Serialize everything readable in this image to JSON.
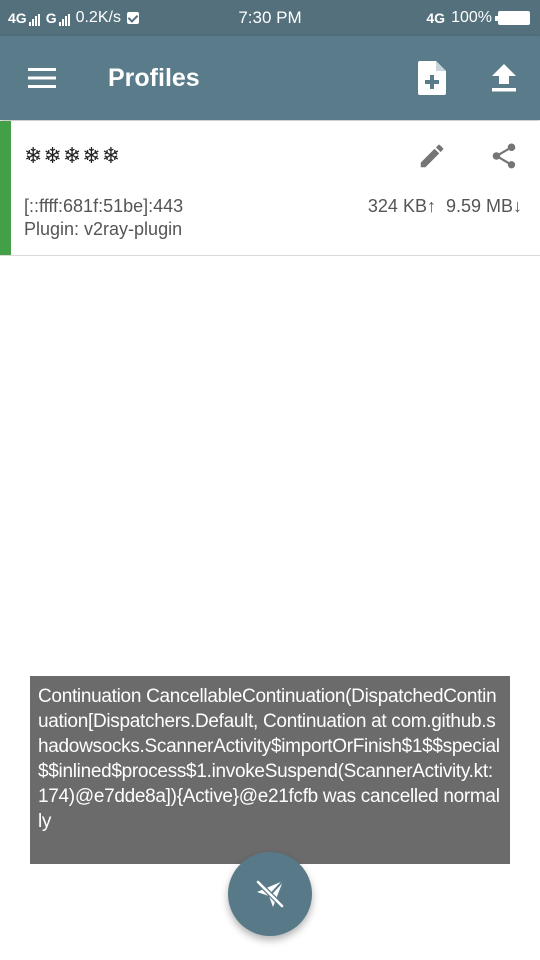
{
  "status_bar": {
    "network1": "4G",
    "network2": "G",
    "speed": "0.2K/s",
    "time": "7:30 PM",
    "network3": "4G",
    "battery": "100%"
  },
  "app_bar": {
    "title": "Profiles",
    "menu_icon": "menu-icon",
    "new_profile_icon": "add-file-icon",
    "import_icon": "upload-icon"
  },
  "profile": {
    "name": "❄❄❄❄❄",
    "address": "[::ffff:681f:51be]:443",
    "plugin": "Plugin: v2ray-plugin",
    "tx": "324 KB↑",
    "rx": "9.59 MB↓",
    "active_color": "#43a047",
    "edit_icon": "pencil-icon",
    "share_icon": "share-icon"
  },
  "toast": {
    "message": "Continuation CancellableContinuation(DispatchedContinuation[Dispatchers.Default, Continuation at com.github.shadowsocks.ScannerActivity$importOrFinish$1$$special$$inlined$process$1.invokeSuspend(ScannerActivity.kt:174)@e7dde8a]){Active}@e21fcfb was cancelled normally"
  },
  "fab": {
    "icon": "airplane-off-icon"
  },
  "colors": {
    "status_bar": "#53707c",
    "app_bar": "#5a7b89",
    "toast": "#6b6b6b",
    "fab": "#587a88"
  }
}
